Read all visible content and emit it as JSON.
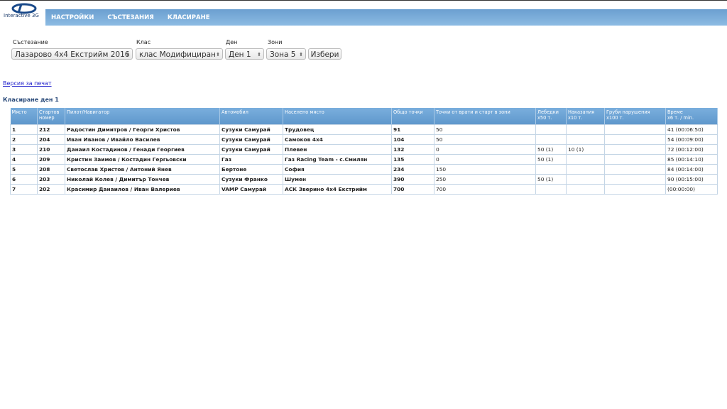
{
  "logo": {
    "text": "Interactive 3G"
  },
  "nav": [
    "НАСТРОЙКИ",
    "СЪСТЕЗАНИЯ",
    "КЛАСИРАНЕ"
  ],
  "filters": {
    "competition": {
      "label": "Състезание",
      "value": "Лазарово 4x4 Екстрийм 2016"
    },
    "class": {
      "label": "Клас",
      "value": "клас Модифициран"
    },
    "day": {
      "label": "Ден",
      "value": "Ден 1"
    },
    "zones": {
      "label": "Зони",
      "value": "Зона 5"
    },
    "submit": "Избери"
  },
  "print_link": "Версия за печат",
  "section_title": "Класиране ден 1",
  "table": {
    "headers": [
      [
        "Място",
        ""
      ],
      [
        "Стартов",
        "номер"
      ],
      [
        "Пилот/Навигатор",
        ""
      ],
      [
        "Автомобил",
        ""
      ],
      [
        "Населено място",
        ""
      ],
      [
        "Общо точки",
        ""
      ],
      [
        "Точки от врати и старт в зони",
        ""
      ],
      [
        "Лебедки",
        "x50 т."
      ],
      [
        "Наказания",
        "x10 т."
      ],
      [
        "Груби нарушения",
        "x100 т."
      ],
      [
        "Време",
        "x6 т. / min."
      ]
    ],
    "rows": [
      [
        "1",
        "212",
        "Радостин Димитров / Георги Христов",
        "Сузуки Самурай",
        "Трудовец",
        "91",
        "50",
        "",
        "",
        "",
        "41 (00:06:50)"
      ],
      [
        "2",
        "204",
        "Иван Иванов / Ивайло Василев",
        "Сузуки Самурай",
        "Самоков 4x4",
        "104",
        "50",
        "",
        "",
        "",
        "54 (00:09:00)"
      ],
      [
        "3",
        "210",
        "Данаил Костадинов / Генади Георгиев",
        "Сузуки Самурай",
        "Плевен",
        "132",
        "0",
        "50 (1)",
        "10 (1)",
        "",
        "72 (00:12:00)"
      ],
      [
        "4",
        "209",
        "Кристин Заимов / Костадин Гергьовски",
        "Газ",
        "Газ Racing Team - с.Смилян",
        "135",
        "0",
        "50 (1)",
        "",
        "",
        "85 (00:14:10)"
      ],
      [
        "5",
        "208",
        "Светослав Христов / Антоний Янев",
        "Бертоне",
        "София",
        "234",
        "150",
        "",
        "",
        "",
        "84 (00:14:00)"
      ],
      [
        "6",
        "203",
        "Николай Колев / Димитър Тончев",
        "Сузуки Франко",
        "Шумен",
        "390",
        "250",
        "50 (1)",
        "",
        "",
        "90 (00:15:00)"
      ],
      [
        "7",
        "202",
        "Красимир Данаилов / Иван Валериев",
        "VAMP Самурай",
        "АСК Зверино 4x4 Екстрийм",
        "700",
        "700",
        "",
        "",
        "",
        "(00:00:00)"
      ]
    ]
  }
}
